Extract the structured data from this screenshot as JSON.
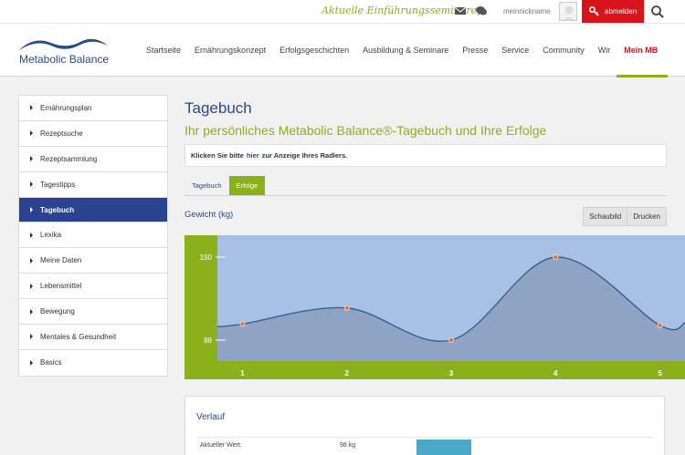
{
  "topbar": {
    "seminar_link": "Aktuelle Einführungsseminare",
    "nickname": "meinnickname",
    "logout_label": "abmelden"
  },
  "header": {
    "logo_text": "Metabolic Balance",
    "nav": [
      "Startseite",
      "Ernährungskonzept",
      "Erfolgsgeschichten",
      "Ausbildung & Seminare",
      "Presse",
      "Service",
      "Community",
      "Wir",
      "Mein MB"
    ],
    "active_nav": "Mein MB"
  },
  "sidebar": {
    "items": [
      "Ernährungsplan",
      "Rezeptsuche",
      "Rezeptsammlung",
      "Tagestipps",
      "Tagebuch",
      "Lexika",
      "Meine Daten",
      "Lebensmittel",
      "Bewegung",
      "Mentales & Gesundheit",
      "Basics"
    ],
    "active": "Tagebuch"
  },
  "main": {
    "title": "Tagebuch",
    "subtitle": "Ihr persönliches Metabolic Balance®-Tagebuch und Ihre Erfolge",
    "notice_pre": "Klicken Sie bitte",
    "notice_link": "hier",
    "notice_post": "zur Anzeige Ihres Radlers.",
    "tabs": [
      "Tagebuch",
      "Erfolge"
    ],
    "active_tab": "Erfolge",
    "chart_label": "Gewicht (kg)",
    "btn_chart": "Schaubild",
    "btn_print": "Drucken"
  },
  "chart_data": {
    "type": "area",
    "x": [
      1,
      2,
      3,
      4,
      5
    ],
    "values": [
      100,
      112,
      88,
      150,
      99
    ],
    "y_ticks": [
      88,
      150
    ],
    "ylim": [
      88,
      150
    ],
    "colors": {
      "frame": "#8ab01c",
      "plot_bg": "#a8c0e4",
      "area": "#8fa3c4",
      "line": "#3b5e94",
      "marker": "#e8733a"
    }
  },
  "verlauf": {
    "title": "Verlauf",
    "label": "Aktueller Wert:",
    "value": "98 kg"
  }
}
